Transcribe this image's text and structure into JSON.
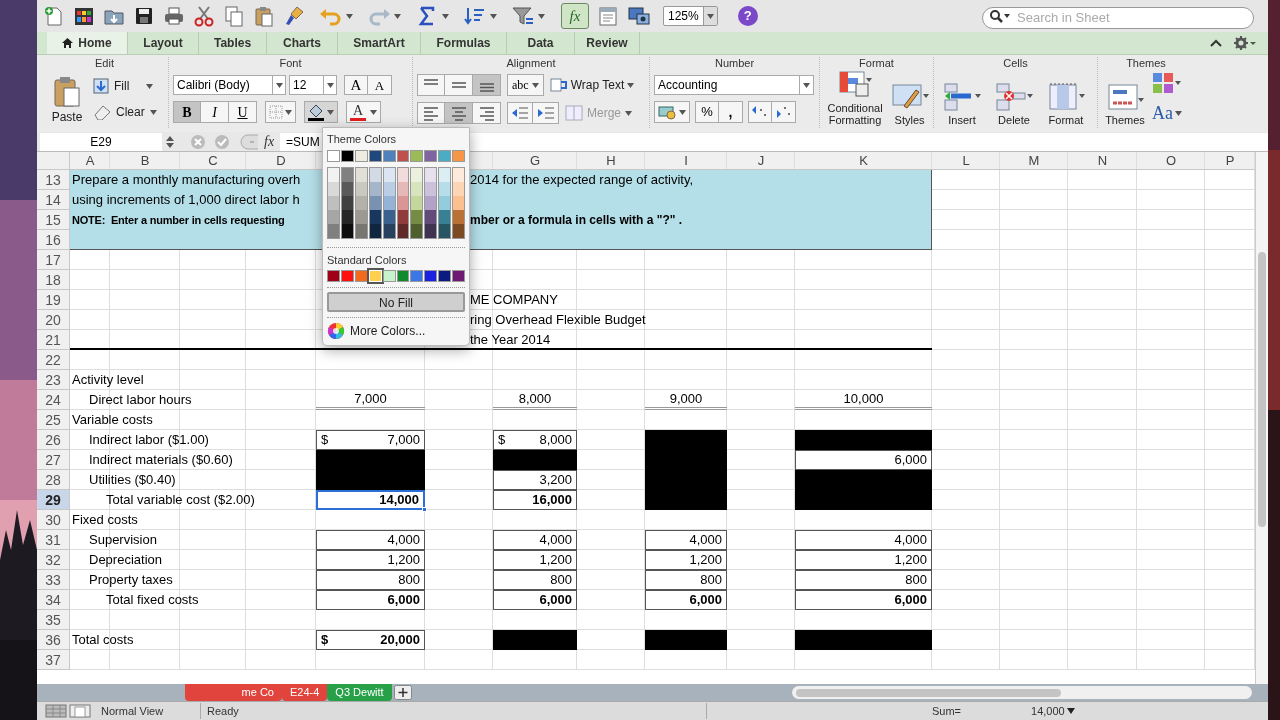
{
  "toolbar": {
    "formula_builder": {
      "label": "fx",
      "pressed": true
    },
    "zoom": "125%",
    "help": "?",
    "search": {
      "placeholder": "Search in Sheet"
    }
  },
  "ribbon_tabs": [
    {
      "label": "Home",
      "selected": true
    },
    {
      "label": "Layout",
      "selected": false
    },
    {
      "label": "Tables",
      "selected": false
    },
    {
      "label": "Charts",
      "selected": false
    },
    {
      "label": "SmartArt",
      "selected": false
    },
    {
      "label": "Formulas",
      "selected": false
    },
    {
      "label": "Data",
      "selected": false
    },
    {
      "label": "Review",
      "selected": false
    }
  ],
  "ribbon": {
    "edit": {
      "title": "Edit",
      "paste": "Paste",
      "fill": "Fill",
      "clear": "Clear"
    },
    "font": {
      "title": "Font",
      "font_name": "Calibri (Body)",
      "font_size": "12",
      "grow": "A",
      "shrink": "A",
      "bold": {
        "label": "B",
        "on": true
      },
      "italic": {
        "label": "I",
        "on": false
      },
      "underline": {
        "label": "U",
        "on": false
      },
      "fill_color": {
        "color": "#000000"
      },
      "font_color": {
        "label": "A",
        "color": "#e02020"
      }
    },
    "alignment": {
      "title": "Alignment",
      "vertical": [
        {
          "selected": false
        },
        {
          "selected": false
        },
        {
          "selected": true
        }
      ],
      "horizontal": [
        {
          "selected": false
        },
        {
          "selected": true
        },
        {
          "selected": false
        }
      ],
      "orientation": "abc",
      "wrap_text": "Wrap Text",
      "merge": {
        "label": "Merge",
        "disabled": true
      }
    },
    "number": {
      "title": "Number",
      "format": "Accounting",
      "percent": "%",
      "comma": ","
    },
    "format": {
      "title": "Format",
      "conditional_formatting": "Conditional Formatting",
      "styles": "Styles"
    },
    "cells": {
      "title": "Cells",
      "insert": "Insert",
      "delete": "Delete",
      "format": "Format"
    },
    "themes": {
      "title": "Themes",
      "themes": "Themes",
      "fonts": "Aa"
    }
  },
  "formula_bar": {
    "cell": "E29",
    "fx": "fx",
    "formula": "=SUM"
  },
  "sheet": {
    "columns": [
      "A",
      "B",
      "C",
      "D",
      "G",
      "H",
      "I",
      "J",
      "K",
      "L",
      "M",
      "N",
      "O",
      "P"
    ],
    "rows": [
      {
        "number": "13",
        "selected": false,
        "shaded": true,
        "rule_below": false,
        "label": {
          "kind": "band_text",
          "bold": false,
          "text": "Prepare a monthly manufacturing overh"
        },
        "continued": {
          "bold": false,
          "text": "2014 for the expected range of activity,"
        }
      },
      {
        "number": "14",
        "selected": false,
        "shaded": true,
        "rule_below": false,
        "label": {
          "kind": "band_text",
          "bold": false,
          "text": "using increments of 1,000 direct labor h"
        }
      },
      {
        "number": "15",
        "selected": false,
        "shaded": true,
        "rule_below": false,
        "label": {
          "kind": "band_text",
          "bold": true,
          "text": "NOTE:  Enter a number in cells requesting"
        },
        "continued": {
          "bold": true,
          "text": "mber or a formula in cells with a \"?\" ."
        }
      },
      {
        "number": "16",
        "selected": false,
        "shaded": true,
        "rule_below": false
      },
      {
        "number": "17",
        "selected": false,
        "shaded": false,
        "rule_below": false
      },
      {
        "number": "18",
        "selected": false,
        "shaded": false,
        "rule_below": false
      },
      {
        "number": "19",
        "selected": false,
        "shaded": false,
        "rule_below": false,
        "continued": {
          "bold": false,
          "text": "ME COMPANY"
        }
      },
      {
        "number": "20",
        "selected": false,
        "shaded": false,
        "rule_below": false,
        "continued": {
          "bold": false,
          "text": "ring Overhead Flexible Budget"
        }
      },
      {
        "number": "21",
        "selected": false,
        "shaded": false,
        "rule_below": true,
        "continued": {
          "bold": false,
          "text": "the Year 2014"
        }
      },
      {
        "number": "22",
        "selected": false,
        "shaded": false,
        "rule_below": false
      },
      {
        "number": "23",
        "selected": false,
        "shaded": false,
        "rule_below": false,
        "label": {
          "kind": "heading",
          "bold": false,
          "text": "Activity level"
        }
      },
      {
        "number": "24",
        "selected": false,
        "shaded": false,
        "rule_below": false,
        "label": {
          "kind": "item",
          "bold": false,
          "text": "Direct labor hours"
        },
        "values": [
          {
            "kind": "count",
            "bold": false,
            "text": "7,000"
          },
          {
            "kind": "count",
            "bold": false,
            "text": "8,000"
          },
          {
            "kind": "count",
            "bold": false,
            "text": "9,000"
          },
          {
            "kind": "count",
            "bold": false,
            "text": "10,000"
          }
        ]
      },
      {
        "number": "25",
        "selected": false,
        "shaded": false,
        "rule_below": false,
        "label": {
          "kind": "heading",
          "bold": false,
          "text": "Variable costs"
        }
      },
      {
        "number": "26",
        "selected": false,
        "shaded": false,
        "rule_below": false,
        "label": {
          "kind": "item",
          "bold": false,
          "text": "Indirect labor ($1.00)"
        },
        "values": [
          {
            "kind": "value",
            "bold": false,
            "filled": false,
            "selected": false,
            "currency": "$",
            "text": "7,000"
          },
          {
            "kind": "value",
            "bold": false,
            "filled": false,
            "selected": false,
            "currency": "$",
            "text": "8,000"
          },
          {
            "kind": "value",
            "filled": true,
            "selected": false
          },
          {
            "kind": "value",
            "filled": true,
            "selected": false
          }
        ]
      },
      {
        "number": "27",
        "selected": false,
        "shaded": false,
        "rule_below": false,
        "label": {
          "kind": "item",
          "bold": false,
          "text": "Indirect materials ($0.60)"
        },
        "values": [
          {
            "kind": "value",
            "filled": true,
            "selected": false
          },
          {
            "kind": "value",
            "filled": true,
            "selected": false
          },
          {
            "kind": "value",
            "filled": true,
            "selected": false
          },
          {
            "kind": "value",
            "bold": false,
            "filled": false,
            "selected": false,
            "text": "6,000"
          }
        ]
      },
      {
        "number": "28",
        "selected": false,
        "shaded": false,
        "rule_below": false,
        "label": {
          "kind": "item",
          "bold": false,
          "text": "Utilities ($0.40)"
        },
        "values": [
          {
            "kind": "value",
            "filled": true,
            "selected": false
          },
          {
            "kind": "value",
            "bold": false,
            "filled": false,
            "selected": false,
            "text": "3,200"
          },
          {
            "kind": "value",
            "filled": true,
            "selected": false
          },
          {
            "kind": "value",
            "filled": true,
            "selected": false
          }
        ]
      },
      {
        "number": "29",
        "selected": true,
        "shaded": false,
        "rule_below": false,
        "label": {
          "kind": "total",
          "bold": false,
          "text": "Total variable cost ($2.00)"
        },
        "values": [
          {
            "kind": "value",
            "bold": true,
            "filled": false,
            "selected": true,
            "text": "14,000"
          },
          {
            "kind": "value",
            "bold": true,
            "filled": false,
            "selected": false,
            "text": "16,000"
          },
          {
            "kind": "value",
            "filled": true,
            "selected": false
          },
          {
            "kind": "value",
            "filled": true,
            "selected": false
          }
        ]
      },
      {
        "number": "30",
        "selected": false,
        "shaded": false,
        "rule_below": false,
        "label": {
          "kind": "heading",
          "bold": false,
          "text": "Fixed costs"
        }
      },
      {
        "number": "31",
        "selected": false,
        "shaded": false,
        "rule_below": false,
        "label": {
          "kind": "item",
          "bold": false,
          "text": "Supervision"
        },
        "values": [
          {
            "kind": "value",
            "bold": false,
            "filled": false,
            "selected": false,
            "text": "4,000"
          },
          {
            "kind": "value",
            "bold": false,
            "filled": false,
            "selected": false,
            "text": "4,000"
          },
          {
            "kind": "value",
            "bold": false,
            "filled": false,
            "selected": false,
            "text": "4,000"
          },
          {
            "kind": "value",
            "bold": false,
            "filled": false,
            "selected": false,
            "text": "4,000"
          }
        ]
      },
      {
        "number": "32",
        "selected": false,
        "shaded": false,
        "rule_below": false,
        "label": {
          "kind": "item",
          "bold": false,
          "text": "Depreciation"
        },
        "values": [
          {
            "kind": "value",
            "bold": false,
            "filled": false,
            "selected": false,
            "text": "1,200"
          },
          {
            "kind": "value",
            "bold": false,
            "filled": false,
            "selected": false,
            "text": "1,200"
          },
          {
            "kind": "value",
            "bold": false,
            "filled": false,
            "selected": false,
            "text": "1,200"
          },
          {
            "kind": "value",
            "bold": false,
            "filled": false,
            "selected": false,
            "text": "1,200"
          }
        ]
      },
      {
        "number": "33",
        "selected": false,
        "shaded": false,
        "rule_below": false,
        "label": {
          "kind": "item",
          "bold": false,
          "text": "Property taxes"
        },
        "values": [
          {
            "kind": "value",
            "bold": false,
            "filled": false,
            "selected": false,
            "text": "800"
          },
          {
            "kind": "value",
            "bold": false,
            "filled": false,
            "selected": false,
            "text": "800"
          },
          {
            "kind": "value",
            "bold": false,
            "filled": false,
            "selected": false,
            "text": "800"
          },
          {
            "kind": "value",
            "bold": false,
            "filled": false,
            "selected": false,
            "text": "800"
          }
        ]
      },
      {
        "number": "34",
        "selected": false,
        "shaded": false,
        "rule_below": false,
        "label": {
          "kind": "total",
          "bold": false,
          "text": "Total fixed costs"
        },
        "values": [
          {
            "kind": "value",
            "bold": true,
            "filled": false,
            "selected": false,
            "text": "6,000"
          },
          {
            "kind": "value",
            "bold": true,
            "filled": false,
            "selected": false,
            "text": "6,000"
          },
          {
            "kind": "value",
            "bold": true,
            "filled": false,
            "selected": false,
            "text": "6,000"
          },
          {
            "kind": "value",
            "bold": true,
            "filled": false,
            "selected": false,
            "text": "6,000"
          }
        ]
      },
      {
        "number": "35",
        "selected": false,
        "shaded": false,
        "rule_below": false
      },
      {
        "number": "36",
        "selected": false,
        "shaded": false,
        "rule_below": false,
        "label": {
          "kind": "heading",
          "bold": false,
          "text": "Total costs"
        },
        "values": [
          {
            "kind": "value",
            "bold": true,
            "filled": false,
            "selected": false,
            "currency": "$",
            "text": "20,000"
          },
          {
            "kind": "value",
            "filled": true,
            "selected": false
          },
          {
            "kind": "value",
            "filled": true,
            "selected": false
          },
          {
            "kind": "value",
            "filled": true,
            "selected": false
          }
        ]
      },
      {
        "number": "37",
        "selected": false,
        "shaded": false,
        "rule_below": false
      }
    ]
  },
  "color_menu": {
    "theme_title": "Theme Colors",
    "theme_colors": [
      {
        "color": "#ffffff"
      },
      {
        "color": "#000000"
      },
      {
        "color": "#eeece1"
      },
      {
        "color": "#1f497d"
      },
      {
        "color": "#4f81bd"
      },
      {
        "color": "#c0504d"
      },
      {
        "color": "#9bbb59"
      },
      {
        "color": "#8064a2"
      },
      {
        "color": "#4bacc6"
      },
      {
        "color": "#f79646"
      }
    ],
    "standard_title": "Standard Colors",
    "standard_colors": [
      {
        "color": "#a00018",
        "highlighted": false
      },
      {
        "color": "#ff1010",
        "highlighted": false
      },
      {
        "color": "#f26a1e",
        "highlighted": false
      },
      {
        "color": "#ffd050",
        "highlighted": true
      },
      {
        "color": "#c6f3cb",
        "highlighted": false
      },
      {
        "color": "#0f8a2c",
        "highlighted": false
      },
      {
        "color": "#3a78e8",
        "highlighted": false
      },
      {
        "color": "#1a22e0",
        "highlighted": false
      },
      {
        "color": "#0b1b80",
        "highlighted": false
      },
      {
        "color": "#6f1a72",
        "highlighted": false
      }
    ],
    "no_fill": "No Fill",
    "more_colors": "More Colors..."
  },
  "sheet_tabs": [
    {
      "label": "me Co",
      "color": "#e0443c"
    },
    {
      "label": "E24-4",
      "color": "#e0443c"
    },
    {
      "label": "Q3 Dewitt",
      "color": "#27a048"
    }
  ],
  "status_bar": {
    "view": "Normal View",
    "mode": "Ready",
    "sum_label": "Sum=",
    "sum_value": "14,000"
  }
}
